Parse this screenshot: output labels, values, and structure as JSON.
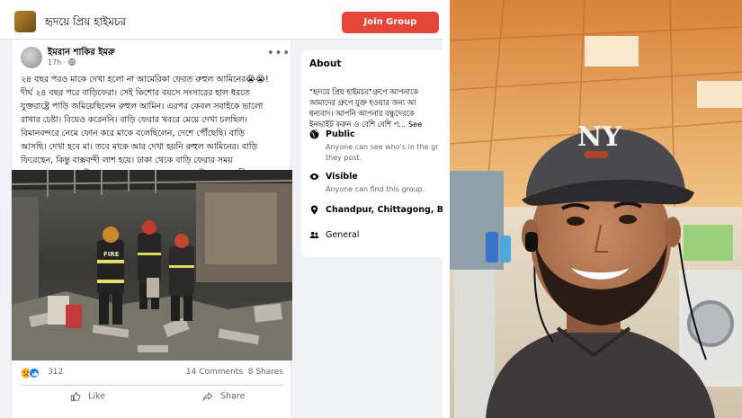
{
  "group": {
    "name": "হৃদয়ে প্রিয় হাইমচর",
    "join_label": "Join Group"
  },
  "post": {
    "author": "ইমরান শাকির ইমরু",
    "time": "17h · ",
    "caption_lines": [
      "২৪ বছর পরও মাকে দেখা হলো না আমেরিকা ফেরত রুহুল আমিনের😭😭!",
      "দীর্ঘ ২৪ বছর পরে বাড়িফেরা। সেই কিশোর বয়সে সংসারের হাল ধরতে",
      "যুক্তরাষ্ট্রে পাড়ি জমিয়েছিলেন রুহুল আমিন। এরপর কেবল সবাইকে ভালো",
      "রাখার চেষ্টা। বিয়েও করেননি। বাড়ি ফেরার খবরে মেয়ে দেখা চলছিল।",
      "বিমানবন্দরে নেমে ফোন করে মাকে বলেছিলেন, দেশে পৌঁছেছি। বাড়ি",
      "আসছি। দেখা হবে মা। তবে মাকে আর দেখা হয়নি রুহুল আমিনের। বাড়ি",
      "ফিরেছেন, কিন্তু বাক্সবন্দী লাশ হয়ে। ঢাকা থেকে বাড়ি ফেরার সময়",
      "মগবাজারে ভয়াবহ বিস্ফোরণে প্রাণ হারালেন রুহুল আমিন। আহা জীবন...!!"
    ],
    "reaction_count": "312",
    "comments": "14 Comments",
    "shares": "8 Shares",
    "like_label": "Like",
    "share_label": "Share",
    "photo_text": "FIRE"
  },
  "about": {
    "title": "About",
    "description_lines": [
      "\"হৃদয়ে প্রিয় হাইমচর\"গ্রুপে আপনাকে",
      "আমাদের গ্রুপে যুক্ত হওয়ার জন্য আ",
      "ধন্যবাদ। আপনি আপনার বন্ধুদেরকে",
      "ইনভাইট করুন ও বেশি বেশি প... See"
    ],
    "public_title": "Public",
    "public_sub": [
      "Anyone can see who's in the gr",
      "they post."
    ],
    "visible_title": "Visible",
    "visible_sub": "Anyone can find this group.",
    "location": "Chandpur, Chittagong, Ban",
    "category": "General"
  },
  "selfie": {
    "cap_logo": "NY"
  },
  "colors": {
    "join_button": "#e4463a",
    "page_background": "#f0f2f5",
    "secondary_text": "#65676b"
  }
}
